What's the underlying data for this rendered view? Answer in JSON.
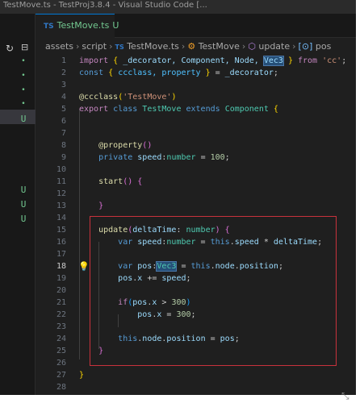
{
  "window": {
    "title": "TestMove.ts - TestProj3.8.4 - Visual Studio Code [..."
  },
  "tab": {
    "type_badge": "TS",
    "filename": "TestMove.ts",
    "status": "U"
  },
  "breadcrumb": [
    "assets",
    "script",
    "TestMove.ts",
    "TestMove",
    "update",
    "pos"
  ],
  "explorer_markers": [
    "•",
    "•",
    "•",
    "•",
    "U",
    "U",
    "U",
    "U"
  ],
  "code": {
    "active_line": 18,
    "lines": [
      [
        {
          "t": "import",
          "c": "kw"
        },
        {
          "t": " "
        },
        {
          "t": "{",
          "c": "br1"
        },
        {
          "t": " _decorator, Component, Node, ",
          "c": "var"
        },
        {
          "t": "Vec3",
          "c": "var",
          "sel": true
        },
        {
          "t": " "
        },
        {
          "t": "}",
          "c": "br1"
        },
        {
          "t": " from ",
          "c": "kw"
        },
        {
          "t": "'cc'",
          "c": "str"
        },
        {
          "t": ";"
        }
      ],
      [
        {
          "t": "const",
          "c": "st"
        },
        {
          "t": " "
        },
        {
          "t": "{",
          "c": "br1"
        },
        {
          "t": " ccclass, property ",
          "c": "cv"
        },
        {
          "t": "}",
          "c": "br1"
        },
        {
          "t": " = "
        },
        {
          "t": "_decorator",
          "c": "var"
        },
        {
          "t": ";"
        }
      ],
      [],
      [
        {
          "t": "@",
          "c": "fn"
        },
        {
          "t": "ccclass",
          "c": "fn"
        },
        {
          "t": "(",
          "c": "br1"
        },
        {
          "t": "'TestMove'",
          "c": "str"
        },
        {
          "t": ")",
          "c": "br1"
        }
      ],
      [
        {
          "t": "export",
          "c": "kw"
        },
        {
          "t": " "
        },
        {
          "t": "class",
          "c": "st"
        },
        {
          "t": " "
        },
        {
          "t": "TestMove",
          "c": "cls"
        },
        {
          "t": " "
        },
        {
          "t": "extends",
          "c": "st"
        },
        {
          "t": " "
        },
        {
          "t": "Component",
          "c": "cls"
        },
        {
          "t": " "
        },
        {
          "t": "{",
          "c": "br1"
        }
      ],
      [],
      [],
      [
        {
          "t": "    "
        },
        {
          "t": "@",
          "c": "fn"
        },
        {
          "t": "property",
          "c": "fn"
        },
        {
          "t": "()",
          "c": "br2"
        }
      ],
      [
        {
          "t": "    "
        },
        {
          "t": "private",
          "c": "st"
        },
        {
          "t": " "
        },
        {
          "t": "speed",
          "c": "var"
        },
        {
          "t": ":"
        },
        {
          "t": "number",
          "c": "cls"
        },
        {
          "t": " = "
        },
        {
          "t": "100",
          "c": "num"
        },
        {
          "t": ";"
        }
      ],
      [],
      [
        {
          "t": "    "
        },
        {
          "t": "start",
          "c": "fn"
        },
        {
          "t": "()",
          "c": "br2"
        },
        {
          "t": " "
        },
        {
          "t": "{",
          "c": "br2"
        }
      ],
      [],
      [
        {
          "t": "    "
        },
        {
          "t": "}",
          "c": "br2"
        }
      ],
      [],
      [
        {
          "t": "    "
        },
        {
          "t": "update",
          "c": "fn"
        },
        {
          "t": "(",
          "c": "br2"
        },
        {
          "t": "deltaTime",
          "c": "var"
        },
        {
          "t": ": "
        },
        {
          "t": "number",
          "c": "cls"
        },
        {
          "t": ")",
          "c": "br2"
        },
        {
          "t": " "
        },
        {
          "t": "{",
          "c": "br2"
        }
      ],
      [
        {
          "t": "        "
        },
        {
          "t": "var",
          "c": "st"
        },
        {
          "t": " "
        },
        {
          "t": "speed",
          "c": "var"
        },
        {
          "t": ":"
        },
        {
          "t": "number",
          "c": "cls"
        },
        {
          "t": " = "
        },
        {
          "t": "this",
          "c": "st"
        },
        {
          "t": "."
        },
        {
          "t": "speed",
          "c": "var"
        },
        {
          "t": " * "
        },
        {
          "t": "deltaTime",
          "c": "var"
        },
        {
          "t": ";"
        }
      ],
      [],
      [
        {
          "t": "        "
        },
        {
          "t": "var",
          "c": "st"
        },
        {
          "t": " "
        },
        {
          "t": "pos",
          "c": "var"
        },
        {
          "t": ":"
        },
        {
          "t": "Vec3",
          "c": "cls",
          "sel": true
        },
        {
          "t": " = "
        },
        {
          "t": "this",
          "c": "st"
        },
        {
          "t": "."
        },
        {
          "t": "node",
          "c": "var"
        },
        {
          "t": "."
        },
        {
          "t": "position",
          "c": "var"
        },
        {
          "t": ";"
        }
      ],
      [
        {
          "t": "        "
        },
        {
          "t": "pos",
          "c": "var"
        },
        {
          "t": "."
        },
        {
          "t": "x",
          "c": "var"
        },
        {
          "t": " += "
        },
        {
          "t": "speed",
          "c": "var"
        },
        {
          "t": ";"
        }
      ],
      [],
      [
        {
          "t": "        "
        },
        {
          "t": "if",
          "c": "kw"
        },
        {
          "t": "(",
          "c": "br3"
        },
        {
          "t": "pos",
          "c": "var"
        },
        {
          "t": "."
        },
        {
          "t": "x",
          "c": "var"
        },
        {
          "t": " > "
        },
        {
          "t": "300",
          "c": "num"
        },
        {
          "t": ")",
          "c": "br3"
        }
      ],
      [
        {
          "t": "            "
        },
        {
          "t": "pos",
          "c": "var"
        },
        {
          "t": "."
        },
        {
          "t": "x",
          "c": "var"
        },
        {
          "t": " = "
        },
        {
          "t": "300",
          "c": "num"
        },
        {
          "t": ";"
        }
      ],
      [],
      [
        {
          "t": "        "
        },
        {
          "t": "this",
          "c": "st"
        },
        {
          "t": "."
        },
        {
          "t": "node",
          "c": "var"
        },
        {
          "t": "."
        },
        {
          "t": "position",
          "c": "var"
        },
        {
          "t": " = "
        },
        {
          "t": "pos",
          "c": "var"
        },
        {
          "t": ";"
        }
      ],
      [
        {
          "t": "    "
        },
        {
          "t": "}",
          "c": "br2"
        }
      ],
      [],
      [
        {
          "t": "}",
          "c": "br1"
        }
      ],
      []
    ]
  },
  "colors": {
    "accent": "#0078d4",
    "modified": "#73c991",
    "highlight_box": "#c8323c"
  }
}
